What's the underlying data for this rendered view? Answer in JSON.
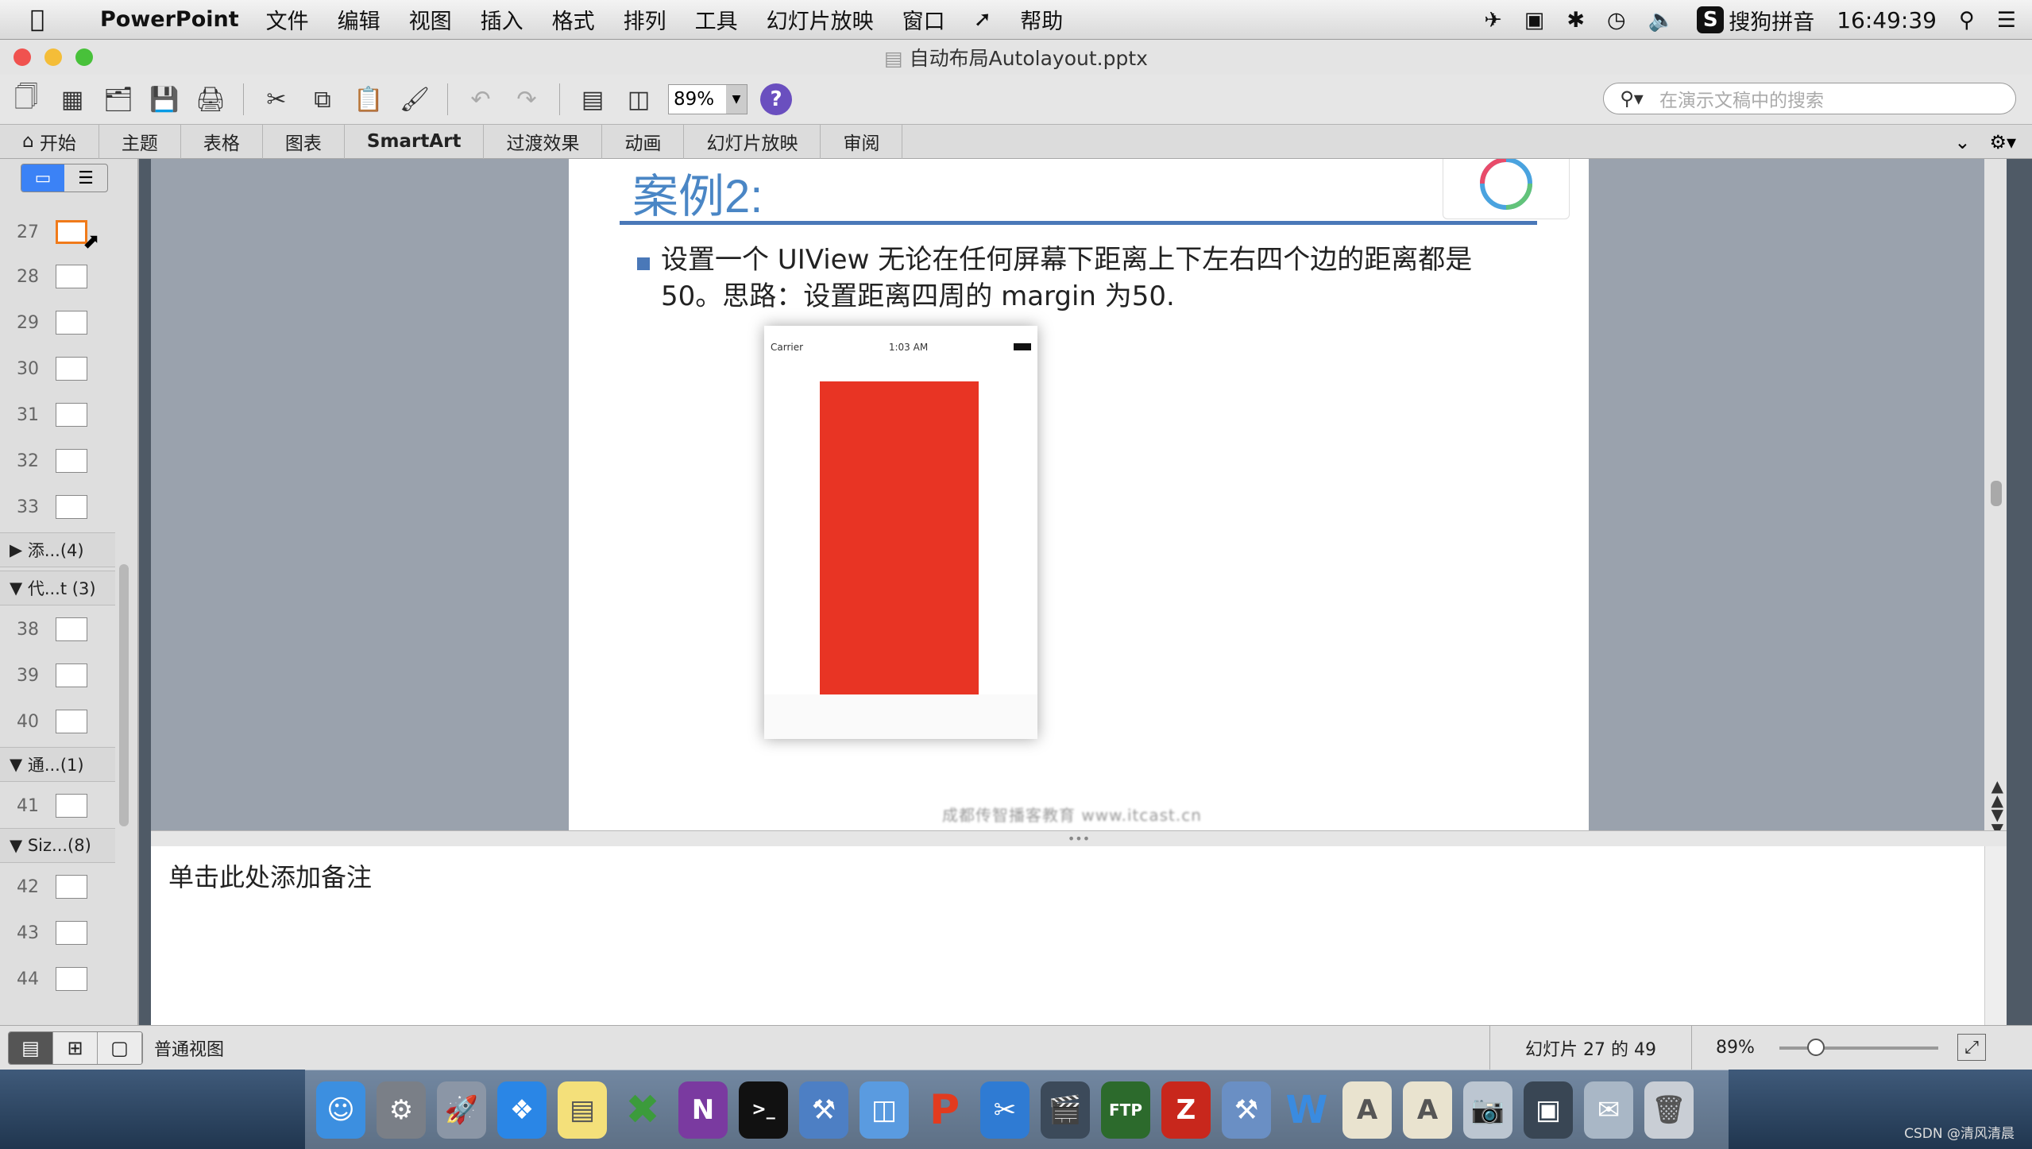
{
  "menubar": {
    "apple": "",
    "app_name": "PowerPoint",
    "items": [
      "文件",
      "编辑",
      "视图",
      "插入",
      "格式",
      "排列",
      "工具",
      "幻灯片放映",
      "窗口",
      "帮助"
    ],
    "input_method": "搜狗拼音",
    "clock": "16:49:39"
  },
  "window": {
    "title": "自动布局Autolayout.pptx"
  },
  "toolbar": {
    "zoom": "89%",
    "search_placeholder": "在演示文稿中的搜索"
  },
  "ribbon": {
    "tabs": [
      "开始",
      "主题",
      "表格",
      "图表",
      "SmartArt",
      "过渡效果",
      "动画",
      "幻灯片放映",
      "审阅"
    ]
  },
  "slide_panel": {
    "thumbs_top": [
      "27",
      "28",
      "29",
      "30",
      "31",
      "32",
      "33"
    ],
    "section1": "添...(4)",
    "section2": "代...t (3)",
    "thumbs_mid": [
      "38",
      "39",
      "40"
    ],
    "section3": "通...(1)",
    "thumbs_mid2": [
      "41"
    ],
    "section4": "Siz...(8)",
    "thumbs_bottom": [
      "42",
      "43",
      "44"
    ]
  },
  "slide": {
    "title": "案例2:",
    "bullet_text": "设置一个 UIView 无论在任何屏幕下距离上下左右四个边的距离都是50。思路：设置距离四周的 margin 为50.",
    "phone_carrier": "Carrier",
    "phone_time": "1:03 AM",
    "red_view_color": "#e83424",
    "footer": "成都传智播客教育 www.itcast.cn"
  },
  "notes": {
    "placeholder": "单击此处添加备注"
  },
  "statusbar": {
    "view_name": "普通视图",
    "slide_counter": "幻灯片 27 的 49",
    "zoom": "89%"
  },
  "watermark": "CSDN @清风清晨"
}
